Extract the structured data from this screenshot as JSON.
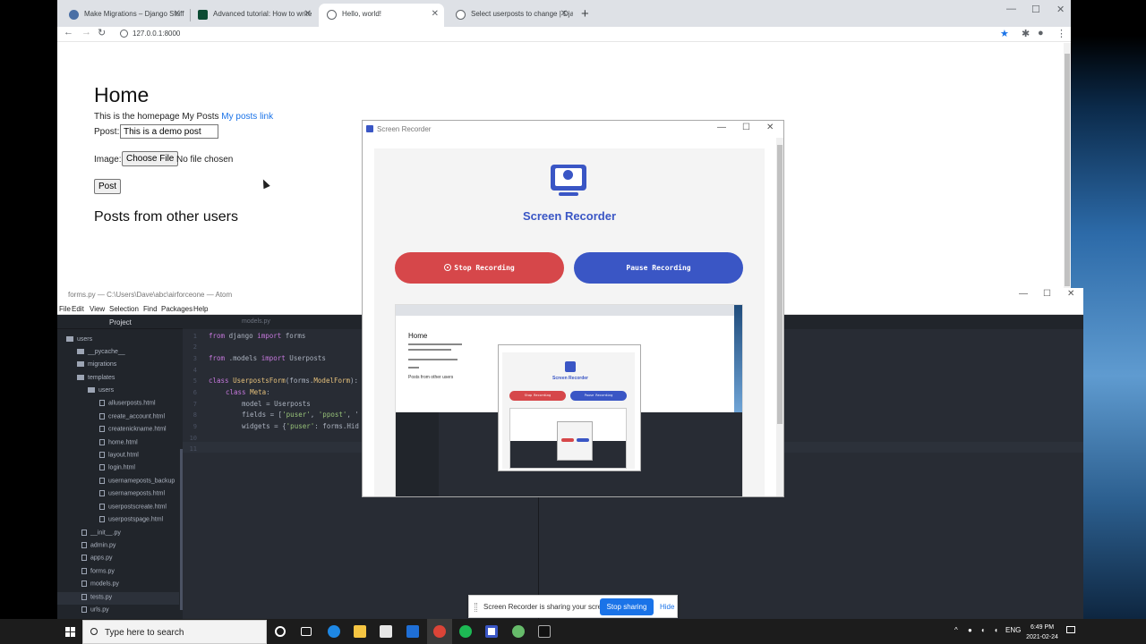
{
  "browser": {
    "tabs": [
      {
        "title": "Make Migrations – Django Stuff"
      },
      {
        "title": "Advanced tutorial: How to write"
      },
      {
        "title": "Hello, world!"
      },
      {
        "title": "Select userposts to change | Dja"
      }
    ],
    "url": "127.0.0.1:8000"
  },
  "page": {
    "heading": "Home",
    "intro": "This is the homepage My Posts",
    "link": "My posts link",
    "ppost_label": "Ppost:",
    "ppost_value": "This is a demo post",
    "image_label": "Image:",
    "choose_file": "Choose File",
    "no_file": "No file chosen",
    "post_button": "Post",
    "subheading": "Posts from other users"
  },
  "atom": {
    "title": "forms.py — C:\\Users\\Dave\\abc\\airforceone — Atom",
    "menu": [
      "File",
      "Edit",
      "View",
      "Selection",
      "Find",
      "Packages",
      "Help"
    ],
    "project_label": "Project",
    "editor_tab": "models.py",
    "tree": [
      {
        "label": "users",
        "kind": "folder"
      },
      {
        "label": "__pycache__",
        "kind": "folder"
      },
      {
        "label": "migrations",
        "kind": "folder"
      },
      {
        "label": "templates",
        "kind": "folder"
      },
      {
        "label": "users",
        "kind": "folder"
      },
      {
        "label": "alluserposts.html",
        "kind": "file"
      },
      {
        "label": "create_account.html",
        "kind": "file"
      },
      {
        "label": "createnickname.html",
        "kind": "file"
      },
      {
        "label": "home.html",
        "kind": "file"
      },
      {
        "label": "layout.html",
        "kind": "file"
      },
      {
        "label": "login.html",
        "kind": "file"
      },
      {
        "label": "usernameposts_backup",
        "kind": "file"
      },
      {
        "label": "usernameposts.html",
        "kind": "file"
      },
      {
        "label": "userpostscreate.html",
        "kind": "file"
      },
      {
        "label": "userpostspage.html",
        "kind": "file"
      },
      {
        "label": "__init__.py",
        "kind": "file"
      },
      {
        "label": "admin.py",
        "kind": "file"
      },
      {
        "label": "apps.py",
        "kind": "file"
      },
      {
        "label": "forms.py",
        "kind": "file"
      },
      {
        "label": "models.py",
        "kind": "file"
      },
      {
        "label": "tests.py",
        "kind": "file"
      },
      {
        "label": "urls.py",
        "kind": "file"
      }
    ],
    "line_numbers": [
      "1",
      "2",
      "3",
      "4",
      "5",
      "6",
      "7",
      "8",
      "9",
      "10",
      "11"
    ],
    "code": {
      "l1": {
        "kw1": "from",
        "mod": " django ",
        "kw2": "import",
        "rest": " forms"
      },
      "l3": {
        "kw1": "from",
        "mod": " .models ",
        "kw2": "import",
        "rest": " Userposts"
      },
      "l5": {
        "kw": "class",
        "name": " UserpostsForm",
        "rest": "(forms.",
        "base": "ModelForm",
        "end": "):"
      },
      "l6": {
        "kw": "class",
        "name": " Meta",
        "end": ":"
      },
      "l7": "model = Userposts",
      "l8a": "fields = [",
      "l8b": "'puser'",
      "l8c": ", ",
      "l8d": "'ppost'",
      "l8e": ", '",
      "l9a": "widgets = {",
      "l9b": "'puser'",
      "l9c": ": forms.Hid"
    }
  },
  "recorder": {
    "window_title": "Screen Recorder",
    "heading": "Screen Recorder",
    "stop_label": "Stop Recording",
    "pause_label": "Pause Recording",
    "preview": {
      "home": "Home",
      "posts": "Posts from other users",
      "heading": "Screen Recorder",
      "stop": "Stop Recording",
      "pause": "Pause Recording"
    }
  },
  "share_bar": {
    "message": "Screen Recorder is sharing your screen.",
    "stop_sharing": "Stop sharing",
    "hide": "Hide"
  },
  "taskbar": {
    "search_placeholder": "Type here to search",
    "language": "ENG",
    "time": "6:49 PM",
    "date": "2021-02-24"
  }
}
